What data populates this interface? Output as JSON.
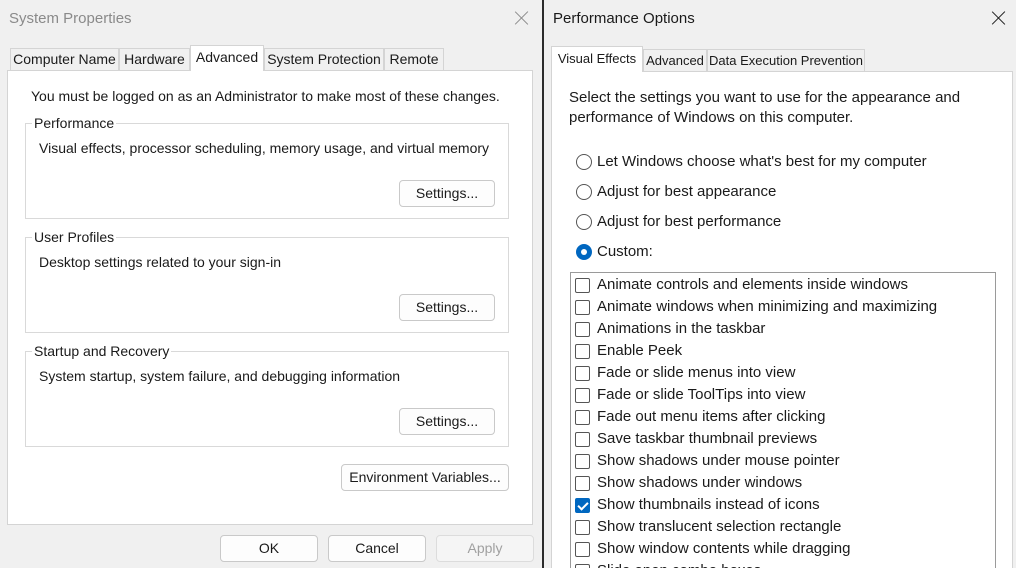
{
  "system_properties": {
    "title": "System Properties",
    "tabs": [
      {
        "label": "Computer Name",
        "active": false
      },
      {
        "label": "Hardware",
        "active": false
      },
      {
        "label": "Advanced",
        "active": true
      },
      {
        "label": "System Protection",
        "active": false
      },
      {
        "label": "Remote",
        "active": false
      }
    ],
    "admin_note": "You must be logged on as an Administrator to make most of these changes.",
    "groups": [
      {
        "title": "Performance",
        "description": "Visual effects, processor scheduling, memory usage, and virtual memory",
        "button": "Settings..."
      },
      {
        "title": "User Profiles",
        "description": "Desktop settings related to your sign-in",
        "button": "Settings..."
      },
      {
        "title": "Startup and Recovery",
        "description": "System startup, system failure, and debugging information",
        "button": "Settings..."
      }
    ],
    "env_button": "Environment Variables...",
    "buttons": {
      "ok": "OK",
      "cancel": "Cancel",
      "apply": "Apply"
    }
  },
  "performance_options": {
    "title": "Performance Options",
    "tabs": [
      {
        "label": "Visual Effects",
        "active": true
      },
      {
        "label": "Advanced",
        "active": false
      },
      {
        "label": "Data Execution Prevention",
        "active": false
      }
    ],
    "intro_line1": "Select the settings you want to use for the appearance and",
    "intro_line2": "performance of Windows on this computer.",
    "radios": [
      {
        "label": "Let Windows choose what's best for my computer",
        "checked": false
      },
      {
        "label": "Adjust for best appearance",
        "checked": false
      },
      {
        "label": "Adjust for best performance",
        "checked": false
      },
      {
        "label": "Custom:",
        "checked": true
      }
    ],
    "effects": [
      {
        "label": "Animate controls and elements inside windows",
        "checked": false
      },
      {
        "label": "Animate windows when minimizing and maximizing",
        "checked": false
      },
      {
        "label": "Animations in the taskbar",
        "checked": false
      },
      {
        "label": "Enable Peek",
        "checked": false
      },
      {
        "label": "Fade or slide menus into view",
        "checked": false
      },
      {
        "label": "Fade or slide ToolTips into view",
        "checked": false
      },
      {
        "label": "Fade out menu items after clicking",
        "checked": false
      },
      {
        "label": "Save taskbar thumbnail previews",
        "checked": false
      },
      {
        "label": "Show shadows under mouse pointer",
        "checked": false
      },
      {
        "label": "Show shadows under windows",
        "checked": false
      },
      {
        "label": "Show thumbnails instead of icons",
        "checked": true
      },
      {
        "label": "Show translucent selection rectangle",
        "checked": false
      },
      {
        "label": "Show window contents while dragging",
        "checked": false
      },
      {
        "label": "Slide open combo boxes",
        "checked": false
      }
    ]
  }
}
